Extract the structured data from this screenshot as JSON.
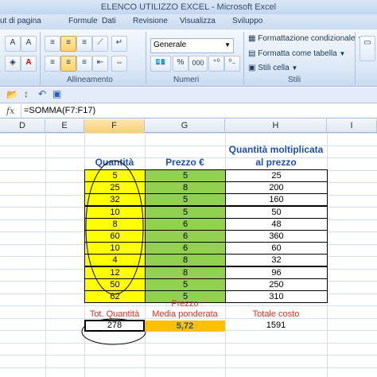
{
  "window": {
    "title": "ELENCO UTILIZZO EXCEL - Microsoft Excel"
  },
  "ribbon": {
    "tabs": [
      "ut di pagina",
      "Formule",
      "Dati",
      "Revisione",
      "Visualizza",
      "Sviluppo"
    ],
    "groups": {
      "alignment": "Allineamento",
      "numbers": "Numeri",
      "styles": "Stili"
    },
    "number_format": "Generale",
    "percent": "%",
    "thousands": "000",
    "conditional_formatting": "Formattazione condizionale",
    "format_as_table": "Formatta come tabella",
    "cell_styles": "Stili cella"
  },
  "formula_bar": {
    "fx": "fx",
    "formula": "=SOMMA(F7:F17)"
  },
  "columns": [
    "D",
    "E",
    "F",
    "G",
    "H",
    "I"
  ],
  "table": {
    "headers": {
      "quantity": "Quantità",
      "price": "Prezzo €",
      "product_line1": "Quantità moltiplicata",
      "product_line2": "al prezzo"
    },
    "rows": [
      {
        "q": "5",
        "p": "5",
        "t": "25"
      },
      {
        "q": "25",
        "p": "8",
        "t": "200"
      },
      {
        "q": "32",
        "p": "5",
        "t": "160"
      },
      {
        "q": "10",
        "p": "5",
        "t": "50"
      },
      {
        "q": "8",
        "p": "6",
        "t": "48"
      },
      {
        "q": "60",
        "p": "6",
        "t": "360"
      },
      {
        "q": "10",
        "p": "6",
        "t": "60"
      },
      {
        "q": "4",
        "p": "8",
        "t": "32"
      },
      {
        "q": "12",
        "p": "8",
        "t": "96"
      },
      {
        "q": "50",
        "p": "5",
        "t": "250"
      },
      {
        "q": "62",
        "p": "5",
        "t": "310"
      }
    ]
  },
  "summary": {
    "tot_qty_label": "Tot. Quantità",
    "tot_qty_value": "278",
    "weighted_label1": "Prezzo",
    "weighted_label2": "Media ponderata",
    "weighted_value": "5,72",
    "total_cost_label": "Totale costo",
    "total_cost_value": "1591"
  },
  "colors": {
    "yellow": "#ffff00",
    "green": "#92d050",
    "orange": "#ffc000",
    "header_blue": "#1f4fb0",
    "label_red": "#e03020"
  }
}
